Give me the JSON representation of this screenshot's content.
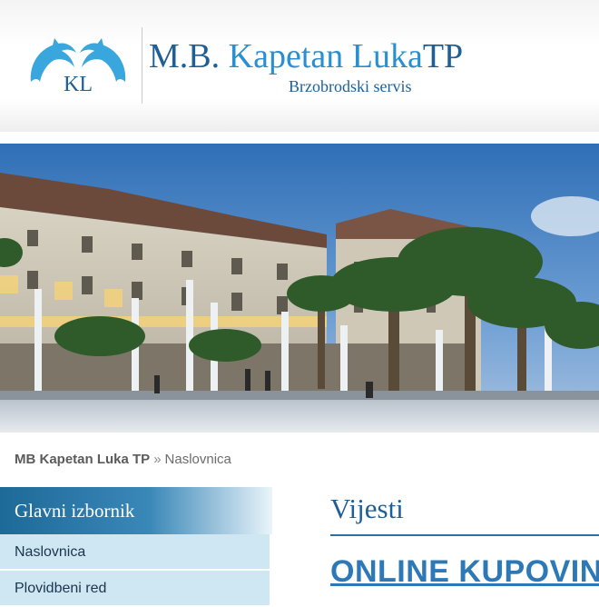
{
  "header": {
    "logo_initials": "KL",
    "brand_prefix": "M.B.",
    "brand_name": "Kapetan Luka",
    "brand_suffix": "TP",
    "tagline": "Brzobrodski servis"
  },
  "breadcrumb": {
    "home": "MB Kapetan Luka TP",
    "separator": "»",
    "current": "Naslovnica"
  },
  "sidebar": {
    "title": "Glavni izbornik",
    "items": [
      {
        "label": "Naslovnica"
      },
      {
        "label": "Plovidbeni red"
      }
    ]
  },
  "main": {
    "section_title": "Vijesti",
    "article_title": "ONLINE KUPOVINA"
  },
  "colors": {
    "brand_dark": "#1f5f95",
    "brand_light": "#2a8fd0",
    "sidebar_item_bg": "#cfe7f2",
    "link": "#2d79b8"
  }
}
